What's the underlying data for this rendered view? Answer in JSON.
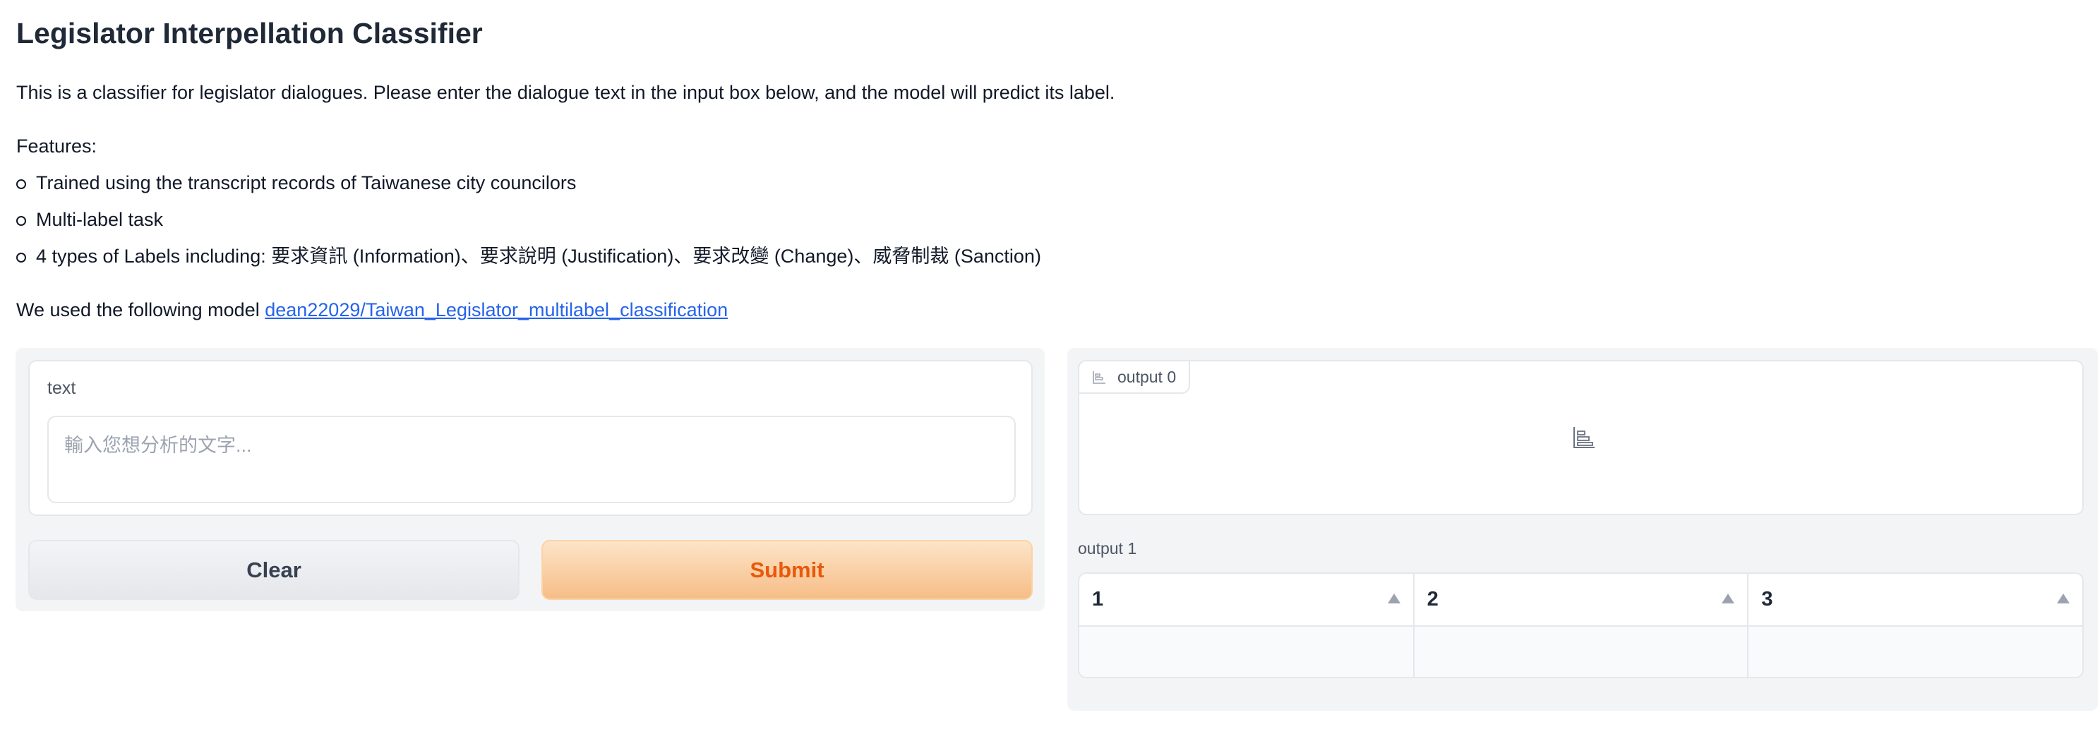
{
  "header": {
    "title": "Legislator Interpellation Classifier",
    "description": "This is a classifier for legislator dialogues. Please enter the dialogue text in the input box below, and the model will predict its label.",
    "features_label": "Features:",
    "features": [
      "Trained using the transcript records of Taiwanese city councilors",
      "Multi-label task",
      "4 types of Labels including: 要求資訊 (Information)、要求說明 (Justification)、要求改變 (Change)、威脅制裁 (Sanction)"
    ],
    "model_prefix": "We used the following model ",
    "model_link": "dean22029/Taiwan_Legislator_multilabel_classification"
  },
  "input": {
    "label": "text",
    "placeholder": "輸入您想分析的文字...",
    "value": ""
  },
  "buttons": {
    "clear_label": "Clear",
    "submit_label": "Submit"
  },
  "output0": {
    "label": "output 0",
    "icon": "bar-chart-icon"
  },
  "output1": {
    "label": "output 1",
    "columns": [
      "1",
      "2",
      "3"
    ]
  },
  "colors": {
    "accent": "#ea580c",
    "link": "#2563eb"
  }
}
